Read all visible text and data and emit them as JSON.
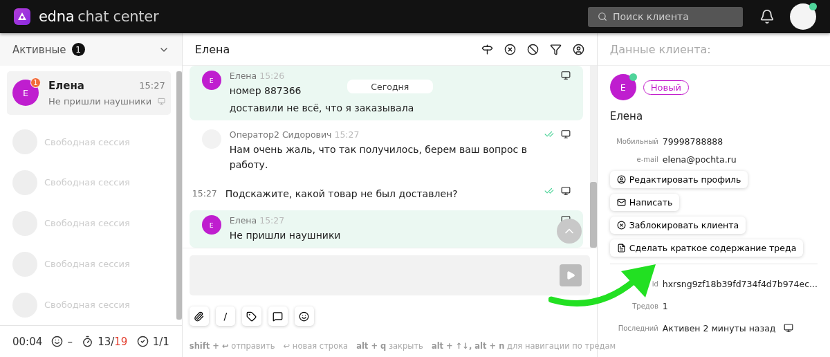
{
  "header": {
    "logo": {
      "brand": "edna",
      "product": "chat center"
    },
    "search": {
      "placeholder": "Поиск клиента"
    },
    "user_online": true
  },
  "sidebar": {
    "filter": {
      "label": "Активные",
      "count": "1"
    },
    "chats": [
      {
        "avatar": "E",
        "name": "Елена",
        "time": "15:27",
        "preview": "Не пришли наушники",
        "unread": "1",
        "selected": true
      }
    ],
    "free_sessions": [
      "Свободная сессия",
      "Свободная сессия",
      "Свободная сессия",
      "Свободная сессия",
      "Свободная сессия"
    ],
    "stats": {
      "duration": "00:04",
      "rating": "–",
      "sla_done": "13",
      "sla_separator": "/",
      "sla_total": "19",
      "closed": "1/1"
    }
  },
  "chat": {
    "title": "Елена",
    "date_divider": "Сегодня",
    "messages": [
      {
        "kind": "client",
        "avatar": "E",
        "author": "Елена",
        "time": "15:26",
        "lines": [
          "номер 887366",
          "доставили не всё, что я заказывала"
        ]
      },
      {
        "kind": "operator",
        "author": "Оператор2 Сидорович",
        "time": "15:27",
        "lines": [
          "Нам очень жаль, что так получилось, берем ваш вопрос в работу."
        ],
        "read": true
      },
      {
        "kind": "operator_cont",
        "time": "15:27",
        "lines": [
          "Подскажите, какой товар не был доставлен?"
        ],
        "read": true
      },
      {
        "kind": "client",
        "avatar": "E",
        "author": "Елена",
        "time": "15:27",
        "lines": [
          "Не пришли наушники"
        ]
      }
    ],
    "composer": {
      "tools": [
        {
          "kind": "attach"
        },
        {
          "kind": "command",
          "label": "/"
        },
        {
          "kind": "tag"
        },
        {
          "kind": "template"
        },
        {
          "kind": "emoji"
        }
      ],
      "hints": [
        {
          "keys": "shift + ↩",
          "action": "отправить",
          "plain": false
        },
        {
          "keys": "↩",
          "action": "новая строка",
          "plain": true
        },
        {
          "keys": "alt + q",
          "action": "закрыть",
          "plain": false
        },
        {
          "keys": "alt + ↑↓, alt + n",
          "action": "для навигации по тредам",
          "plain": false
        }
      ]
    }
  },
  "client": {
    "title": "Данные клиента:",
    "avatar": "E",
    "online": true,
    "status": "Новый",
    "name": "Елена",
    "fields": [
      {
        "label": "Мобильный",
        "value": "79998788888"
      },
      {
        "label": "e-mail",
        "value": "elena@pochta.ru"
      }
    ],
    "actions": [
      {
        "kind": "edit",
        "label": "Редактировать профиль"
      },
      {
        "kind": "write",
        "label": "Написать"
      },
      {
        "kind": "block",
        "label": "Заблокировать клиента"
      },
      {
        "kind": "summary",
        "label": "Сделать краткое содержание треда"
      }
    ],
    "details": [
      {
        "kind": "text",
        "label": "id",
        "value": "hxrsng9zf18b39fd734f4d7b974ec..."
      },
      {
        "kind": "text",
        "label": "Тредов",
        "value": "1"
      },
      {
        "kind": "channel",
        "label": "Последний",
        "value": "Активен 2 минуты назад"
      }
    ]
  }
}
